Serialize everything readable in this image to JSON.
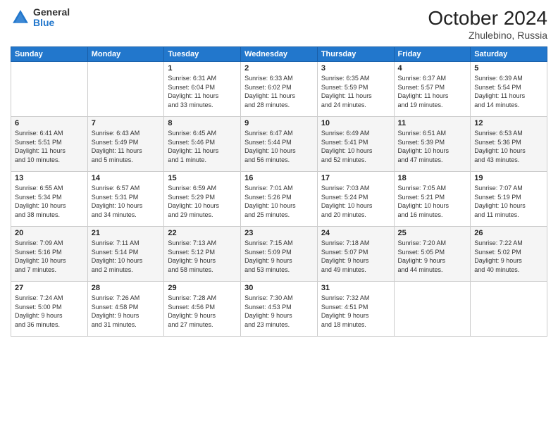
{
  "logo": {
    "general": "General",
    "blue": "Blue"
  },
  "title": "October 2024",
  "location": "Zhulebino, Russia",
  "days_of_week": [
    "Sunday",
    "Monday",
    "Tuesday",
    "Wednesday",
    "Thursday",
    "Friday",
    "Saturday"
  ],
  "weeks": [
    [
      {
        "day": "",
        "info": ""
      },
      {
        "day": "",
        "info": ""
      },
      {
        "day": "1",
        "info": "Sunrise: 6:31 AM\nSunset: 6:04 PM\nDaylight: 11 hours\nand 33 minutes."
      },
      {
        "day": "2",
        "info": "Sunrise: 6:33 AM\nSunset: 6:02 PM\nDaylight: 11 hours\nand 28 minutes."
      },
      {
        "day": "3",
        "info": "Sunrise: 6:35 AM\nSunset: 5:59 PM\nDaylight: 11 hours\nand 24 minutes."
      },
      {
        "day": "4",
        "info": "Sunrise: 6:37 AM\nSunset: 5:57 PM\nDaylight: 11 hours\nand 19 minutes."
      },
      {
        "day": "5",
        "info": "Sunrise: 6:39 AM\nSunset: 5:54 PM\nDaylight: 11 hours\nand 14 minutes."
      }
    ],
    [
      {
        "day": "6",
        "info": "Sunrise: 6:41 AM\nSunset: 5:51 PM\nDaylight: 11 hours\nand 10 minutes."
      },
      {
        "day": "7",
        "info": "Sunrise: 6:43 AM\nSunset: 5:49 PM\nDaylight: 11 hours\nand 5 minutes."
      },
      {
        "day": "8",
        "info": "Sunrise: 6:45 AM\nSunset: 5:46 PM\nDaylight: 11 hours\nand 1 minute."
      },
      {
        "day": "9",
        "info": "Sunrise: 6:47 AM\nSunset: 5:44 PM\nDaylight: 10 hours\nand 56 minutes."
      },
      {
        "day": "10",
        "info": "Sunrise: 6:49 AM\nSunset: 5:41 PM\nDaylight: 10 hours\nand 52 minutes."
      },
      {
        "day": "11",
        "info": "Sunrise: 6:51 AM\nSunset: 5:39 PM\nDaylight: 10 hours\nand 47 minutes."
      },
      {
        "day": "12",
        "info": "Sunrise: 6:53 AM\nSunset: 5:36 PM\nDaylight: 10 hours\nand 43 minutes."
      }
    ],
    [
      {
        "day": "13",
        "info": "Sunrise: 6:55 AM\nSunset: 5:34 PM\nDaylight: 10 hours\nand 38 minutes."
      },
      {
        "day": "14",
        "info": "Sunrise: 6:57 AM\nSunset: 5:31 PM\nDaylight: 10 hours\nand 34 minutes."
      },
      {
        "day": "15",
        "info": "Sunrise: 6:59 AM\nSunset: 5:29 PM\nDaylight: 10 hours\nand 29 minutes."
      },
      {
        "day": "16",
        "info": "Sunrise: 7:01 AM\nSunset: 5:26 PM\nDaylight: 10 hours\nand 25 minutes."
      },
      {
        "day": "17",
        "info": "Sunrise: 7:03 AM\nSunset: 5:24 PM\nDaylight: 10 hours\nand 20 minutes."
      },
      {
        "day": "18",
        "info": "Sunrise: 7:05 AM\nSunset: 5:21 PM\nDaylight: 10 hours\nand 16 minutes."
      },
      {
        "day": "19",
        "info": "Sunrise: 7:07 AM\nSunset: 5:19 PM\nDaylight: 10 hours\nand 11 minutes."
      }
    ],
    [
      {
        "day": "20",
        "info": "Sunrise: 7:09 AM\nSunset: 5:16 PM\nDaylight: 10 hours\nand 7 minutes."
      },
      {
        "day": "21",
        "info": "Sunrise: 7:11 AM\nSunset: 5:14 PM\nDaylight: 10 hours\nand 2 minutes."
      },
      {
        "day": "22",
        "info": "Sunrise: 7:13 AM\nSunset: 5:12 PM\nDaylight: 9 hours\nand 58 minutes."
      },
      {
        "day": "23",
        "info": "Sunrise: 7:15 AM\nSunset: 5:09 PM\nDaylight: 9 hours\nand 53 minutes."
      },
      {
        "day": "24",
        "info": "Sunrise: 7:18 AM\nSunset: 5:07 PM\nDaylight: 9 hours\nand 49 minutes."
      },
      {
        "day": "25",
        "info": "Sunrise: 7:20 AM\nSunset: 5:05 PM\nDaylight: 9 hours\nand 44 minutes."
      },
      {
        "day": "26",
        "info": "Sunrise: 7:22 AM\nSunset: 5:02 PM\nDaylight: 9 hours\nand 40 minutes."
      }
    ],
    [
      {
        "day": "27",
        "info": "Sunrise: 7:24 AM\nSunset: 5:00 PM\nDaylight: 9 hours\nand 36 minutes."
      },
      {
        "day": "28",
        "info": "Sunrise: 7:26 AM\nSunset: 4:58 PM\nDaylight: 9 hours\nand 31 minutes."
      },
      {
        "day": "29",
        "info": "Sunrise: 7:28 AM\nSunset: 4:56 PM\nDaylight: 9 hours\nand 27 minutes."
      },
      {
        "day": "30",
        "info": "Sunrise: 7:30 AM\nSunset: 4:53 PM\nDaylight: 9 hours\nand 23 minutes."
      },
      {
        "day": "31",
        "info": "Sunrise: 7:32 AM\nSunset: 4:51 PM\nDaylight: 9 hours\nand 18 minutes."
      },
      {
        "day": "",
        "info": ""
      },
      {
        "day": "",
        "info": ""
      }
    ]
  ]
}
